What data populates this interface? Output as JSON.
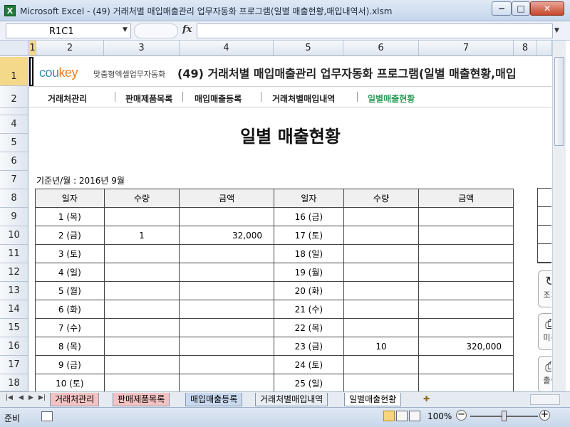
{
  "window": {
    "app_icon": "X",
    "title": "Microsoft Excel - (49) 거래처별 매입매출관리 업무자동화 프로그램(일별 매출현황,매입내역서).xlsm",
    "min_label": "−",
    "max_label": "□",
    "close_label": "✕"
  },
  "formula_bar": {
    "name_box": "R1C1",
    "fx_label": "fx",
    "formula": ""
  },
  "columns": [
    "1",
    "2",
    "3",
    "4",
    "5",
    "6",
    "7",
    "8"
  ],
  "rows": [
    "1",
    "2",
    "3",
    "4",
    "5",
    "6",
    "7",
    "8",
    "9",
    "10",
    "11",
    "12",
    "13",
    "14",
    "15",
    "16",
    "17",
    "18"
  ],
  "banner": {
    "logo_main": "cou",
    "logo_accent": "key",
    "logo_sub": "맞춤형엑셀업무자동화",
    "title": "(49) 거래처별 매입매출관리 업무자동화 프로그램(일별 매출현황,매입"
  },
  "nav": [
    "거래처관리",
    "판매제품목록",
    "매입매출등록",
    "거래처별매입내역",
    "일별매출현황"
  ],
  "page_title": "일별 매출현황",
  "period": "기준년/월 : 2016년 9월",
  "table_headers": [
    "일자",
    "수량",
    "금액"
  ],
  "left_table": [
    {
      "date": "1 (목)",
      "qty": "",
      "amount": ""
    },
    {
      "date": "2 (금)",
      "qty": "1",
      "amount": "32,000"
    },
    {
      "date": "3 (토)",
      "qty": "",
      "amount": ""
    },
    {
      "date": "4 (일)",
      "qty": "",
      "amount": ""
    },
    {
      "date": "5 (월)",
      "qty": "",
      "amount": ""
    },
    {
      "date": "6 (화)",
      "qty": "",
      "amount": ""
    },
    {
      "date": "7 (수)",
      "qty": "",
      "amount": ""
    },
    {
      "date": "8 (목)",
      "qty": "",
      "amount": ""
    },
    {
      "date": "9 (금)",
      "qty": "",
      "amount": ""
    },
    {
      "date": "10 (토)",
      "qty": "",
      "amount": ""
    }
  ],
  "right_table": [
    {
      "date": "16 (금)",
      "qty": "",
      "amount": ""
    },
    {
      "date": "17 (토)",
      "qty": "",
      "amount": ""
    },
    {
      "date": "18 (일)",
      "qty": "",
      "amount": ""
    },
    {
      "date": "19 (월)",
      "qty": "",
      "amount": ""
    },
    {
      "date": "20 (화)",
      "qty": "",
      "amount": ""
    },
    {
      "date": "21 (수)",
      "qty": "",
      "amount": ""
    },
    {
      "date": "22 (목)",
      "qty": "",
      "amount": ""
    },
    {
      "date": "23 (금)",
      "qty": "10",
      "amount": "320,000"
    },
    {
      "date": "24 (토)",
      "qty": "",
      "amount": ""
    },
    {
      "date": "25 (일)",
      "qty": "",
      "amount": ""
    }
  ],
  "side_buttons": [
    {
      "label": "조회",
      "icon": "refresh-icon"
    },
    {
      "label": "미리",
      "icon": "preview-icon"
    },
    {
      "label": "출력",
      "icon": "print-icon"
    }
  ],
  "sheet_tabs": [
    {
      "label": "거래처관리",
      "color": "#f3c2c2"
    },
    {
      "label": "판매제품목록",
      "color": "#f3c2c2"
    },
    {
      "label": "매입매출등록",
      "color": "#c9d9f0"
    },
    {
      "label": "거래처별매입내역",
      "color": "#e8edf3"
    },
    {
      "label": "일별매출현황",
      "color": "#ffffff"
    }
  ],
  "status": {
    "ready": "준비",
    "zoom": "100%",
    "zoom_level": 1.0
  }
}
